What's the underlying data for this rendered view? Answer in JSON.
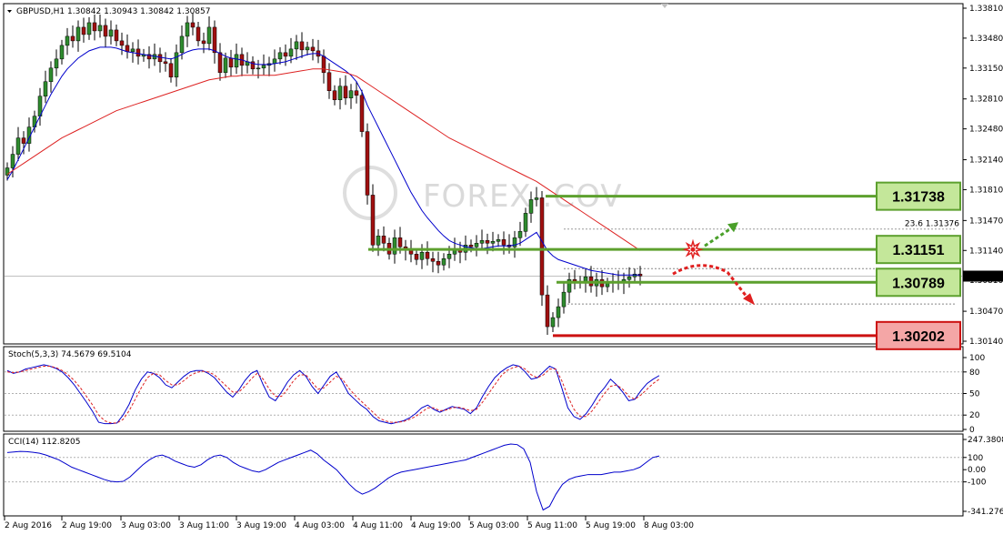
{
  "chart_data": [
    {
      "type": "candlestick",
      "title": "GBPUSD,H1 1.30842 1.30943 1.30842 1.30857",
      "ylim": [
        1.3012,
        1.3385
      ],
      "y_ticks": [
        "1.33810",
        "1.33480",
        "1.33150",
        "1.32810",
        "1.32480",
        "1.32140",
        "1.31810",
        "1.31470",
        "1.31140",
        "1.30810",
        "1.30470",
        "1.30140"
      ],
      "current_price": "1.30857",
      "x_ticks": [
        "2 Aug 2016",
        "2 Aug 19:00",
        "3 Aug 03:00",
        "3 Aug 11:00",
        "3 Aug 19:00",
        "4 Aug 03:00",
        "4 Aug 11:00",
        "4 Aug 19:00",
        "5 Aug 03:00",
        "5 Aug 11:00",
        "5 Aug 19:00",
        "8 Aug 03:00"
      ],
      "closes": [
        1.3205,
        1.322,
        1.3238,
        1.3232,
        1.325,
        1.3262,
        1.3284,
        1.33,
        1.3315,
        1.3325,
        1.334,
        1.335,
        1.3345,
        1.336,
        1.3352,
        1.3365,
        1.3356,
        1.3362,
        1.335,
        1.3357,
        1.3345,
        1.334,
        1.3333,
        1.3336,
        1.3328,
        1.333,
        1.3325,
        1.333,
        1.3322,
        1.332,
        1.3305,
        1.3332,
        1.335,
        1.3365,
        1.336,
        1.3345,
        1.3342,
        1.336,
        1.3332,
        1.331,
        1.3326,
        1.3316,
        1.333,
        1.3318,
        1.3322,
        1.3314,
        1.3315,
        1.3318,
        1.332,
        1.3325,
        1.3332,
        1.3328,
        1.3336,
        1.3344,
        1.3335,
        1.3338,
        1.3334,
        1.3328,
        1.331,
        1.329,
        1.328,
        1.3295,
        1.3282,
        1.329,
        1.3285,
        1.3245,
        1.3175,
        1.312,
        1.313,
        1.3122,
        1.311,
        1.3128,
        1.3118,
        1.3115,
        1.311,
        1.3104,
        1.3112,
        1.3105,
        1.3102,
        1.3098,
        1.3105,
        1.311,
        1.3116,
        1.3112,
        1.312,
        1.3118,
        1.3122,
        1.3125,
        1.3122,
        1.3124,
        1.3126,
        1.312,
        1.3118,
        1.3128,
        1.3135,
        1.3155,
        1.317,
        1.3172,
        1.3065,
        1.303,
        1.304,
        1.3052,
        1.3068,
        1.3082,
        1.308,
        1.3078,
        1.3085,
        1.3075,
        1.3082,
        1.3074,
        1.3078,
        1.308,
        1.3078,
        1.3082,
        1.3085,
        1.3088,
        1.3086
      ],
      "series": [
        {
          "name": "",
          "color": "#0000cc",
          "values": [
            1.3192,
            1.3202,
            1.3214,
            1.3226,
            1.3238,
            1.325,
            1.3262,
            1.3274,
            1.3286,
            1.3296,
            1.3306,
            1.3314,
            1.332,
            1.3326,
            1.333,
            1.3334,
            1.3336,
            1.3338,
            1.3338,
            1.3338,
            1.3337,
            1.3335,
            1.3333,
            1.3332,
            1.3331,
            1.333,
            1.3329,
            1.3328,
            1.3327,
            1.3326,
            1.3325,
            1.3327,
            1.333,
            1.3333,
            1.3335,
            1.3336,
            1.3336,
            1.3336,
            1.3334,
            1.3331,
            1.3328,
            1.3326,
            1.3325,
            1.3324,
            1.3322,
            1.332,
            1.3319,
            1.3319,
            1.3319,
            1.332,
            1.3321,
            1.3322,
            1.3324,
            1.3326,
            1.3328,
            1.333,
            1.3331,
            1.3331,
            1.3328,
            1.3324,
            1.332,
            1.3316,
            1.3312,
            1.3307,
            1.33,
            1.3289,
            1.3274,
            1.3262,
            1.325,
            1.3238,
            1.3226,
            1.3214,
            1.3202,
            1.319,
            1.3178,
            1.3168,
            1.3158,
            1.315,
            1.3143,
            1.3136,
            1.313,
            1.3125,
            1.3122,
            1.312,
            1.3118,
            1.3117,
            1.3116,
            1.3116,
            1.3117,
            1.3118,
            1.3119,
            1.3119,
            1.3119,
            1.312,
            1.3122,
            1.3126,
            1.313,
            1.3134,
            1.3124,
            1.3114,
            1.3108,
            1.3104,
            1.3102,
            1.31,
            1.3098,
            1.3096,
            1.3094,
            1.3092,
            1.3091,
            1.309,
            1.3089,
            1.3088,
            1.3087,
            1.3087,
            1.3087,
            1.3087,
            1.3087
          ]
        },
        {
          "name": "",
          "color": "#dd2222",
          "values": [
            1.3198,
            1.3202,
            1.3206,
            1.321,
            1.3214,
            1.3218,
            1.3222,
            1.3226,
            1.323,
            1.3234,
            1.3238,
            1.3241,
            1.3244,
            1.3247,
            1.325,
            1.3253,
            1.3256,
            1.3259,
            1.3262,
            1.3265,
            1.3268,
            1.327,
            1.3272,
            1.3274,
            1.3276,
            1.3278,
            1.328,
            1.3282,
            1.3284,
            1.3286,
            1.3288,
            1.329,
            1.3292,
            1.3294,
            1.3296,
            1.3298,
            1.33,
            1.3302,
            1.3303,
            1.3304,
            1.3305,
            1.3306,
            1.3306,
            1.3307,
            1.3307,
            1.3307,
            1.3307,
            1.3307,
            1.3307,
            1.3307,
            1.3308,
            1.3309,
            1.331,
            1.3311,
            1.3312,
            1.3313,
            1.3314,
            1.3314,
            1.3314,
            1.3313,
            1.3312,
            1.3311,
            1.331,
            1.3308,
            1.3306,
            1.3302,
            1.3298,
            1.3294,
            1.329,
            1.3286,
            1.3282,
            1.3278,
            1.3274,
            1.327,
            1.3266,
            1.3262,
            1.3258,
            1.3254,
            1.325,
            1.3246,
            1.3242,
            1.3238,
            1.3235,
            1.3232,
            1.3229,
            1.3226,
            1.3223,
            1.322,
            1.3217,
            1.3214,
            1.3211,
            1.3208,
            1.3205,
            1.3202,
            1.3199,
            1.3196,
            1.3193,
            1.319,
            1.3186,
            1.3182,
            1.3178,
            1.3174,
            1.317,
            1.3166,
            1.3162,
            1.3158,
            1.3154,
            1.315,
            1.3146,
            1.3142,
            1.3138,
            1.3134,
            1.313,
            1.3126,
            1.3122,
            1.3118,
            1.3114
          ]
        }
      ],
      "levels": [
        {
          "label": "1.31738",
          "value": 1.31738,
          "color": "#5da02e",
          "fill": "#c4e79a"
        },
        {
          "label": "1.31151",
          "value": 1.31151,
          "color": "#5da02e",
          "fill": "#c4e79a"
        },
        {
          "label": "1.30789",
          "value": 1.30789,
          "color": "#5da02e",
          "fill": "#c4e79a"
        },
        {
          "label": "1.30202",
          "value": 1.30202,
          "color": "#cc1111",
          "fill": "#f4a6a6"
        }
      ],
      "fib_label": "23.6   1.31376",
      "fib_value": 1.31376,
      "watermark": "FOREX      .COV"
    },
    {
      "type": "line",
      "title": "Stoch(5,3,3) 74.5679 69.5104",
      "ylim": [
        0,
        100
      ],
      "y_ticks": [
        "100",
        "80",
        "50",
        "20",
        "0"
      ],
      "series": [
        {
          "name": "",
          "color": "#0000cc",
          "values": [
            82,
            78,
            80,
            84,
            86,
            88,
            90,
            88,
            85,
            80,
            72,
            62,
            50,
            38,
            25,
            10,
            8,
            8,
            9,
            20,
            35,
            55,
            70,
            80,
            78,
            72,
            62,
            58,
            66,
            74,
            80,
            82,
            82,
            78,
            72,
            62,
            52,
            45,
            55,
            68,
            78,
            82,
            62,
            45,
            40,
            52,
            66,
            76,
            82,
            74,
            60,
            50,
            62,
            74,
            80,
            66,
            50,
            42,
            34,
            28,
            18,
            12,
            10,
            8,
            10,
            12,
            16,
            22,
            30,
            34,
            28,
            24,
            28,
            32,
            30,
            28,
            22,
            30,
            46,
            60,
            72,
            80,
            86,
            90,
            88,
            80,
            70,
            72,
            80,
            88,
            84,
            58,
            30,
            18,
            14,
            22,
            34,
            48,
            58,
            70,
            62,
            52,
            40,
            42,
            54,
            64,
            70,
            75
          ]
        },
        {
          "name": "",
          "color": "#dd2222",
          "values": [
            80,
            79,
            80,
            82,
            84,
            86,
            88,
            88,
            86,
            82,
            76,
            68,
            58,
            46,
            34,
            20,
            12,
            9,
            9,
            14,
            26,
            42,
            58,
            72,
            78,
            76,
            68,
            62,
            62,
            68,
            75,
            79,
            81,
            80,
            76,
            68,
            60,
            52,
            52,
            60,
            70,
            78,
            70,
            56,
            46,
            46,
            56,
            68,
            76,
            76,
            66,
            56,
            58,
            66,
            74,
            70,
            58,
            48,
            40,
            32,
            24,
            16,
            12,
            10,
            10,
            11,
            14,
            18,
            24,
            30,
            30,
            26,
            27,
            30,
            31,
            29,
            26,
            28,
            38,
            50,
            62,
            74,
            82,
            86,
            88,
            84,
            76,
            72,
            76,
            84,
            84,
            68,
            46,
            28,
            18,
            18,
            26,
            38,
            50,
            60,
            62,
            56,
            46,
            42,
            48,
            56,
            64,
            70
          ]
        }
      ]
    },
    {
      "type": "line",
      "title": "CCI(14) 112.8205",
      "ylim": [
        -341.2768,
        247.3808
      ],
      "y_ticks": [
        "247.3808",
        "100",
        "0.00",
        "-100",
        "-341.2768"
      ],
      "series": [
        {
          "name": "",
          "color": "#0000cc",
          "values": [
            140,
            145,
            150,
            148,
            142,
            135,
            120,
            100,
            80,
            50,
            20,
            0,
            -20,
            -40,
            -60,
            -80,
            -95,
            -100,
            -95,
            -60,
            -10,
            40,
            80,
            110,
            120,
            100,
            70,
            50,
            30,
            20,
            40,
            80,
            110,
            120,
            100,
            60,
            30,
            10,
            -10,
            -20,
            0,
            30,
            60,
            80,
            100,
            120,
            140,
            160,
            130,
            80,
            40,
            0,
            -60,
            -120,
            -170,
            -200,
            -180,
            -150,
            -110,
            -70,
            -40,
            -20,
            -10,
            0,
            10,
            20,
            30,
            40,
            50,
            60,
            70,
            80,
            100,
            120,
            140,
            160,
            180,
            200,
            210,
            205,
            170,
            60,
            -180,
            -330,
            -300,
            -200,
            -120,
            -80,
            -60,
            -50,
            -40,
            -40,
            -40,
            -30,
            -20,
            -20,
            -10,
            0,
            20,
            60,
            100,
            112
          ]
        }
      ]
    }
  ]
}
